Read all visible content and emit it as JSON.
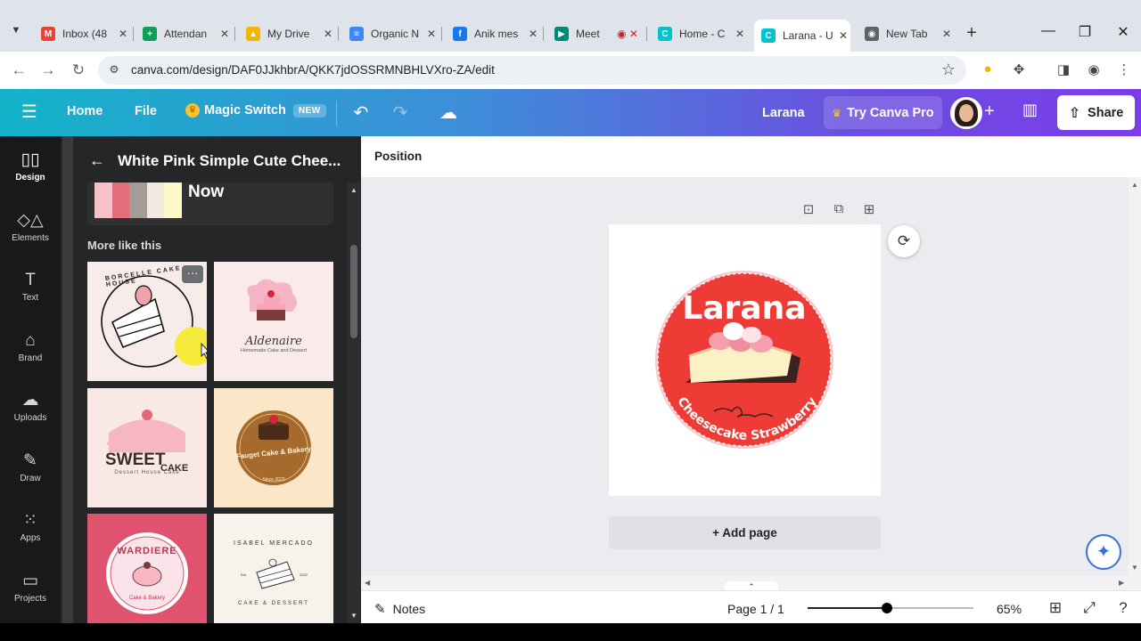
{
  "browser": {
    "tabs": [
      {
        "label": "Inbox (48",
        "fav": "M",
        "color": "#ea4335"
      },
      {
        "label": "Attendan",
        "fav": "+",
        "color": "#0f9d58"
      },
      {
        "label": "My Drive",
        "fav": "▲",
        "color": "#f4b400"
      },
      {
        "label": "Organic N",
        "fav": "≡",
        "color": "#4285f4"
      },
      {
        "label": "Anik mes",
        "fav": "f",
        "color": "#1877f2"
      },
      {
        "label": "Meet",
        "fav": "▶",
        "color": "#00897b"
      },
      {
        "label": "Home - C",
        "fav": "C",
        "color": "#00c4cc"
      },
      {
        "label": "Larana - U",
        "fav": "C",
        "color": "#00c4cc"
      },
      {
        "label": "New Tab",
        "fav": "◉",
        "color": "#5f6368"
      }
    ],
    "url": "canva.com/design/DAF0JJkhbrA/QKK7jdOSSRMNBHLVXro-ZA/edit"
  },
  "header": {
    "home": "Home",
    "file": "File",
    "magic_switch": "Magic Switch",
    "new_badge": "NEW",
    "design_name": "Larana",
    "try_pro": "Try Canva Pro",
    "share": "Share",
    "accent": "#7b3cea"
  },
  "rail": [
    {
      "label": "Design",
      "icon": "▯▯"
    },
    {
      "label": "Elements",
      "icon": "◇△"
    },
    {
      "label": "Text",
      "icon": "T"
    },
    {
      "label": "Brand",
      "icon": "⌂"
    },
    {
      "label": "Uploads",
      "icon": "☁"
    },
    {
      "label": "Draw",
      "icon": "✎"
    },
    {
      "label": "Apps",
      "icon": "⁙"
    },
    {
      "label": "Projects",
      "icon": "▭"
    }
  ],
  "panel": {
    "title": "White Pink Simple Cute Chee...",
    "palette_label": "Now",
    "palette": [
      "#f6c1c7",
      "#e46f7b",
      "#a39c97",
      "#f2e9e1",
      "#fff7c7"
    ],
    "more_like": "More like this",
    "thumbs": [
      {
        "text1": "BORCELLE CAKE HOUSE",
        "bg": "#f8ecea"
      },
      {
        "text1": "Aldenaire",
        "text2": "Homemade Cake and Dessert",
        "bg": "#fbeaea"
      },
      {
        "text1": "SWEET",
        "text2": "CAKE",
        "text3": "Dessert House Cake",
        "bg": "#f9e9e4"
      },
      {
        "text1": "Fauget Cake & Bakery",
        "text2": "Since 2022",
        "bg": "#fbe6c8"
      },
      {
        "text1": "WARDIERE",
        "text2": "Cake & Bakery",
        "bg": "#e0536e"
      },
      {
        "text1": "ISABEL MERCADO",
        "text2": "CAKE & DESSERT",
        "text3": "Est.",
        "text4": "2022",
        "bg": "#f7f2ea"
      }
    ]
  },
  "editor": {
    "position_label": "Position",
    "logo_title": "Larana",
    "logo_subtitle": "Cheesecake Strawberry",
    "logo_red": "#ee3b36",
    "add_page": "+ Add page"
  },
  "footer": {
    "notes": "Notes",
    "page": "Page 1 / 1",
    "zoom_label": "65%",
    "zoom_fraction": 0.48
  }
}
